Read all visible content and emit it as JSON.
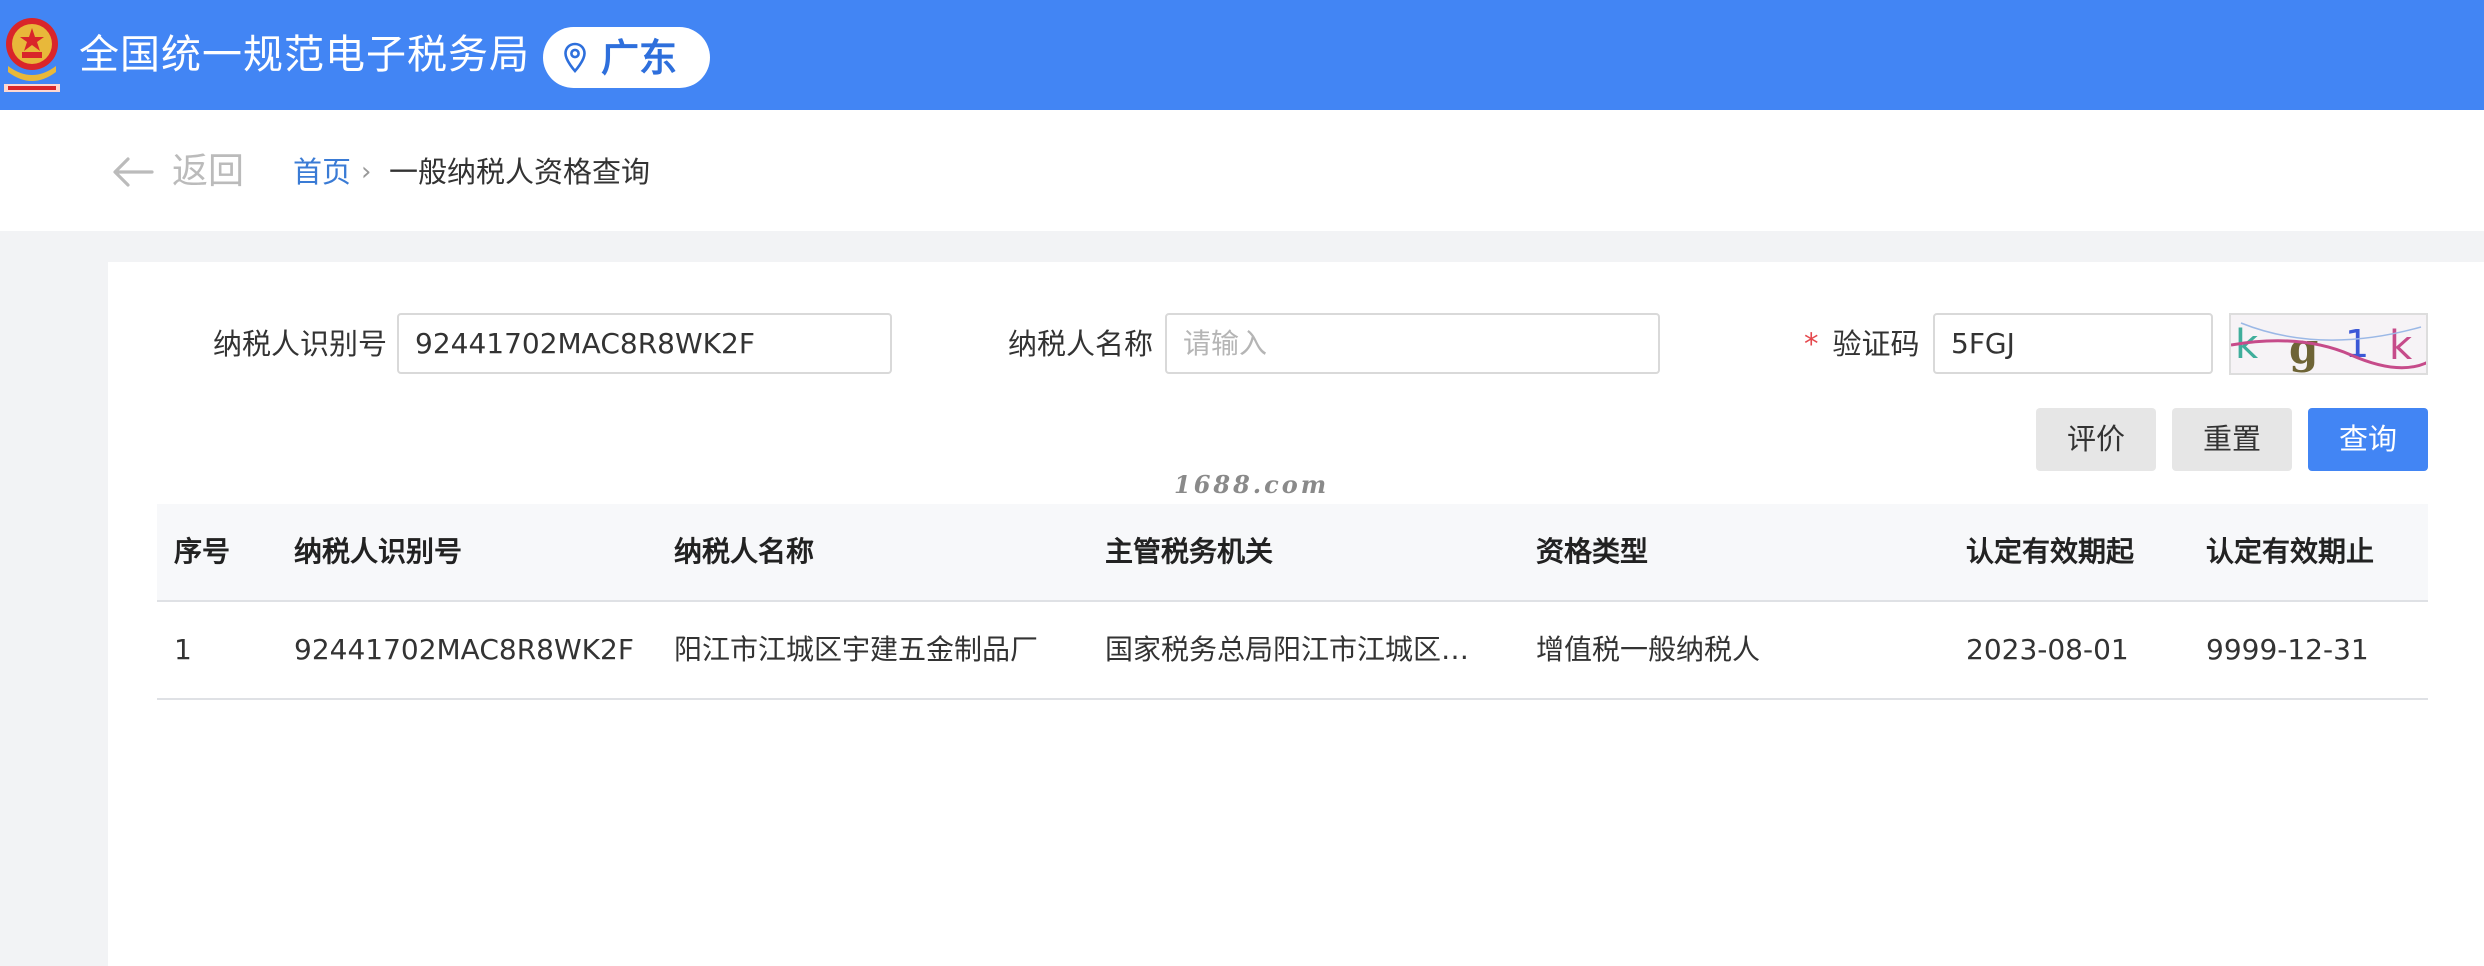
{
  "colors": {
    "header_bg": "#4285f4",
    "primary": "#4285f4",
    "link": "#3a7bd5",
    "required_mark": "#e5484d"
  },
  "header": {
    "logo_icon": "national-emblem-icon",
    "title": "全国统一规范电子税务局",
    "region_icon": "location-pin-icon",
    "region": "广东"
  },
  "breadcrumb": {
    "back_icon": "arrow-left-icon",
    "back_label": "返回",
    "home": "首页",
    "separator": "›",
    "current": "一般纳税人资格查询"
  },
  "form": {
    "taxpayer_id_label": "纳税人识别号",
    "taxpayer_id_value": "92441702MAC8R8WK2F",
    "taxpayer_name_label": "纳税人名称",
    "taxpayer_name_value": "",
    "taxpayer_name_placeholder": "请输入",
    "captcha_required_mark": "*",
    "captcha_label": "验证码",
    "captcha_value": "5FGJ",
    "captcha_image_text": "kg1k"
  },
  "actions": {
    "evaluate": "评价",
    "reset": "重置",
    "query": "查询"
  },
  "watermark": "1688.com",
  "table": {
    "columns": [
      "序号",
      "纳税人识别号",
      "纳税人名称",
      "主管税务机关",
      "资格类型",
      "认定有效期起",
      "认定有效期止"
    ],
    "rows": [
      [
        "1",
        "92441702MAC8R8WK2F",
        "阳江市江城区宇建五金制品厂",
        "国家税务总局阳江市江城区税务局",
        "增值税一般纳税人",
        "2023-08-01",
        "9999-12-31"
      ]
    ]
  }
}
